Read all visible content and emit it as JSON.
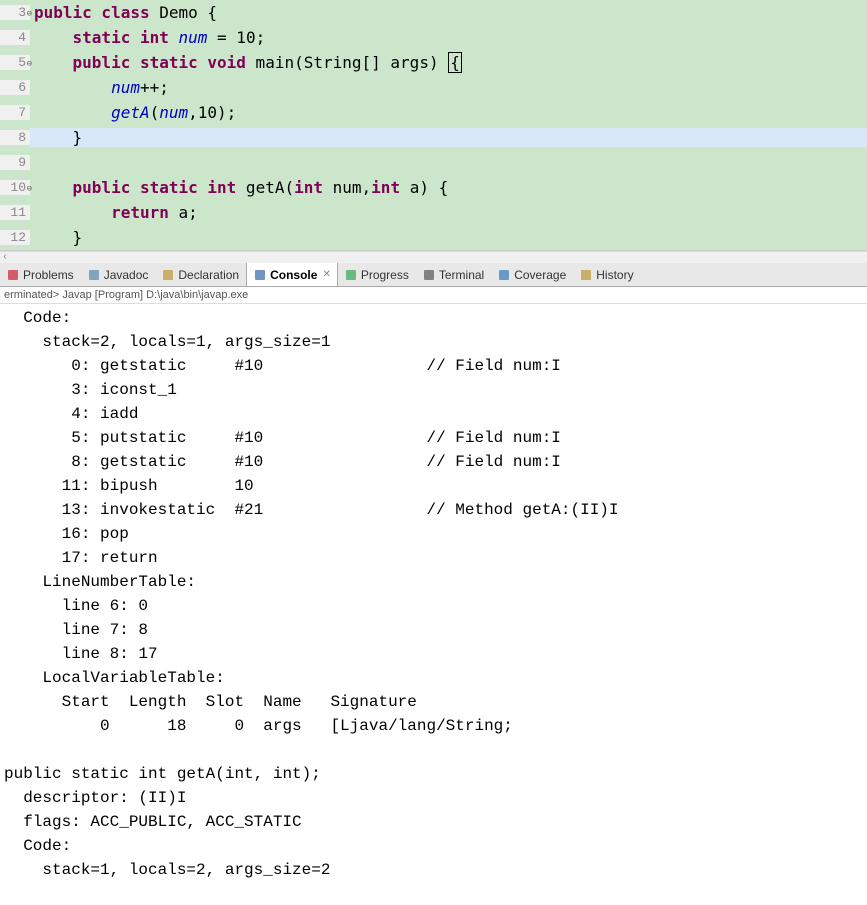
{
  "editor": {
    "lines": [
      {
        "num": "3",
        "fold": "⊖",
        "tokens": [
          [
            "kw",
            "public class"
          ],
          [
            "",
            " Demo {"
          ]
        ]
      },
      {
        "num": "4",
        "tokens": [
          [
            "",
            "    "
          ],
          [
            "kw",
            "static int"
          ],
          [
            "",
            " "
          ],
          [
            "ital",
            "num"
          ],
          [
            "",
            " = 10;"
          ]
        ]
      },
      {
        "num": "5",
        "fold": "⊖",
        "tokens": [
          [
            "",
            "    "
          ],
          [
            "kw",
            "public static void"
          ],
          [
            "",
            " main(String[] args) "
          ],
          [
            "cursor",
            "{"
          ]
        ]
      },
      {
        "num": "6",
        "tokens": [
          [
            "",
            "        "
          ],
          [
            "ital",
            "num"
          ],
          [
            "",
            "++;"
          ]
        ]
      },
      {
        "num": "7",
        "tokens": [
          [
            "",
            "        "
          ],
          [
            "ital",
            "getA"
          ],
          [
            "",
            "("
          ],
          [
            "ital",
            "num"
          ],
          [
            "",
            ",10);"
          ]
        ]
      },
      {
        "num": "8",
        "highlight": true,
        "tokens": [
          [
            "",
            "    }"
          ]
        ]
      },
      {
        "num": "9",
        "tokens": [
          [
            "",
            ""
          ]
        ]
      },
      {
        "num": "10",
        "fold": "⊖",
        "tokens": [
          [
            "",
            "    "
          ],
          [
            "kw",
            "public static int"
          ],
          [
            "",
            " getA("
          ],
          [
            "kw",
            "int"
          ],
          [
            "",
            " num,"
          ],
          [
            "kw",
            "int"
          ],
          [
            "",
            " a) {"
          ]
        ]
      },
      {
        "num": "11",
        "tokens": [
          [
            "",
            "        "
          ],
          [
            "kw",
            "return"
          ],
          [
            "",
            " a;"
          ]
        ]
      },
      {
        "num": "12",
        "tokens": [
          [
            "",
            "    }"
          ]
        ]
      }
    ]
  },
  "tabs": [
    {
      "label": "Problems",
      "icon": "problems-icon",
      "color": "#c23"
    },
    {
      "label": "Javadoc",
      "icon": "javadoc-icon",
      "color": "#58a"
    },
    {
      "label": "Declaration",
      "icon": "declaration-icon",
      "color": "#b93"
    },
    {
      "label": "Console",
      "icon": "console-icon",
      "color": "#36a",
      "active": true,
      "closable": true
    },
    {
      "label": "Progress",
      "icon": "progress-icon",
      "color": "#3a5"
    },
    {
      "label": "Terminal",
      "icon": "terminal-icon",
      "color": "#555"
    },
    {
      "label": "Coverage",
      "icon": "coverage-icon",
      "color": "#37b"
    },
    {
      "label": "History",
      "icon": "history-icon",
      "color": "#b93"
    }
  ],
  "status": "erminated> Javap [Program] D:\\java\\bin\\javap.exe",
  "console": "  Code:\n    stack=2, locals=1, args_size=1\n       0: getstatic     #10                 // Field num:I\n       3: iconst_1\n       4: iadd\n       5: putstatic     #10                 // Field num:I\n       8: getstatic     #10                 // Field num:I\n      11: bipush        10\n      13: invokestatic  #21                 // Method getA:(II)I\n      16: pop\n      17: return\n    LineNumberTable:\n      line 6: 0\n      line 7: 8\n      line 8: 17\n    LocalVariableTable:\n      Start  Length  Slot  Name   Signature\n          0      18     0  args   [Ljava/lang/String;\n\npublic static int getA(int, int);\n  descriptor: (II)I\n  flags: ACC_PUBLIC, ACC_STATIC\n  Code:\n    stack=1, locals=2, args_size=2"
}
